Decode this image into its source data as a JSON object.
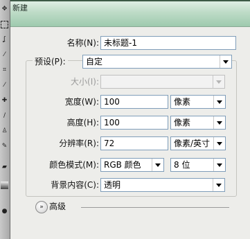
{
  "dialog": {
    "title": "新建",
    "name_label": "名称(N):",
    "name_value": "未标题-1",
    "preset_label": "预设(P):",
    "preset_value": "自定",
    "size_label": "大小(I):",
    "width_label": "宽度(W):",
    "width_value": "100",
    "width_unit": "像素",
    "height_label": "高度(H):",
    "height_value": "100",
    "height_unit": "像素",
    "resolution_label": "分辨率(R):",
    "resolution_value": "72",
    "resolution_unit": "像素/英寸",
    "color_mode_label": "颜色模式(M):",
    "color_mode_value": "RGB 颜色",
    "bit_depth_value": "8 位",
    "background_label": "背景内容(C):",
    "background_value": "透明",
    "advanced_label": "高级"
  },
  "toolbar": {
    "tools": [
      "move-icon",
      "marquee-icon",
      "lasso-icon",
      "magic-wand-icon",
      "crop-icon",
      "eyedropper-icon",
      "healing-brush-icon",
      "brush-icon",
      "clone-stamp-icon",
      "history-brush-icon",
      "eraser-icon",
      "gradient-icon",
      "blur-icon"
    ]
  }
}
